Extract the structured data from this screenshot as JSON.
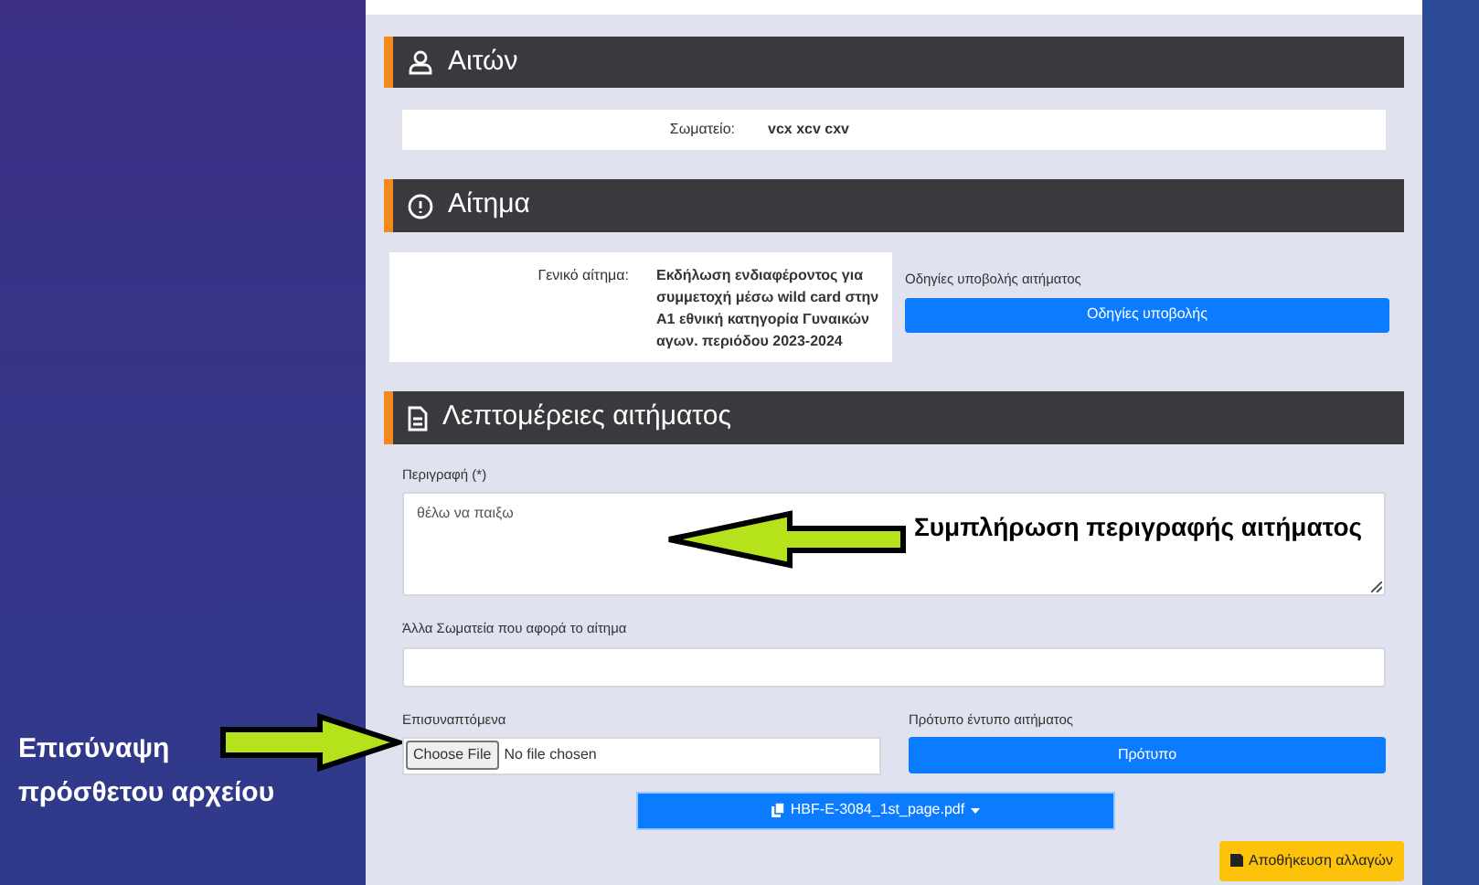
{
  "applicant": {
    "title": "Αιτών",
    "club_label": "Σωματείο:",
    "club_value": "vcx xcv cxv"
  },
  "request": {
    "title": "Αίτημα",
    "general_label": "Γενικό αίτημα:",
    "general_value": "Εκδήλωση ενδιαφέροντος για συμμετοχή μέσω wild card στην A1 εθνική κατηγορία Γυναικών αγων. περιόδου 2023-2024",
    "instructions_label": "Οδηγίες υποβολής αιτήματος",
    "instructions_button": "Οδηγίες υποβολής"
  },
  "details": {
    "title": "Λεπτομέρειες αιτήματος",
    "description_label": "Περιγραφή (*)",
    "description_value": "θέλω να παιξω",
    "other_clubs_label": "Άλλα Σωματεία που αφορά το αίτημα",
    "attachments_label": "Επισυναπτόμενα",
    "file_button": "Choose File",
    "file_status": "No file chosen",
    "template_label": "Πρότυπο έντυπο αιτήματος",
    "template_button": "Πρότυπο",
    "file_dropdown": "HBF-E-3084_1st_page.pdf",
    "save_button": "Αποθήκευση αλλαγών"
  },
  "annotations": [
    {
      "kind": "left",
      "text": "Συμπλήρωση περιγραφής αιτήματος"
    },
    {
      "kind": "right",
      "text": "Επισύναψη πρόσθετου αρχείου"
    }
  ]
}
